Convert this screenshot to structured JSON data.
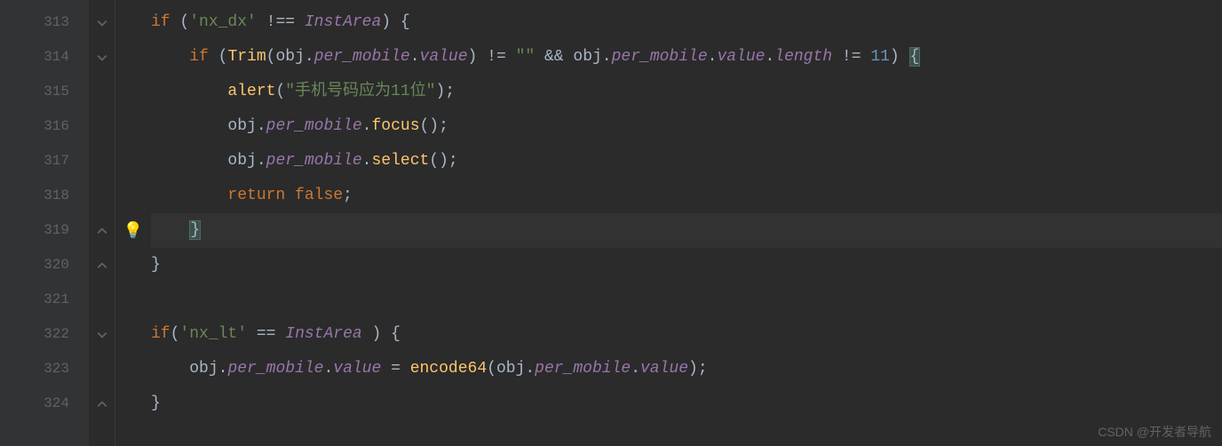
{
  "gutter": {
    "line_numbers": [
      "313",
      "314",
      "315",
      "316",
      "317",
      "318",
      "319",
      "320",
      "321",
      "322",
      "323",
      "324"
    ]
  },
  "fold_markers": {
    "0": "open-start",
    "1": "open-start",
    "6": "close",
    "7": "close",
    "9": "open-start",
    "11": "close"
  },
  "bulb_row_index": 6,
  "highlighted_row_index": 6,
  "code": {
    "lines": [
      [
        {
          "t": "if",
          "c": "k"
        },
        {
          "t": " (",
          "c": "punc"
        },
        {
          "t": "'nx_dx'",
          "c": "s"
        },
        {
          "t": " !== ",
          "c": "punc"
        },
        {
          "t": "InstArea",
          "c": "var-i"
        },
        {
          "t": ") {",
          "c": "punc"
        }
      ],
      [
        {
          "t": "    ",
          "c": "punc"
        },
        {
          "t": "if",
          "c": "k"
        },
        {
          "t": " (",
          "c": "punc"
        },
        {
          "t": "Trim",
          "c": "fn"
        },
        {
          "t": "(",
          "c": "punc"
        },
        {
          "t": "obj",
          "c": "id"
        },
        {
          "t": ".",
          "c": "punc"
        },
        {
          "t": "per_mobile",
          "c": "prop"
        },
        {
          "t": ".",
          "c": "punc"
        },
        {
          "t": "value",
          "c": "prop"
        },
        {
          "t": ") != ",
          "c": "punc"
        },
        {
          "t": "\"\"",
          "c": "s"
        },
        {
          "t": " && ",
          "c": "punc"
        },
        {
          "t": "obj",
          "c": "id"
        },
        {
          "t": ".",
          "c": "punc"
        },
        {
          "t": "per_mobile",
          "c": "prop"
        },
        {
          "t": ".",
          "c": "punc"
        },
        {
          "t": "value",
          "c": "prop"
        },
        {
          "t": ".",
          "c": "punc"
        },
        {
          "t": "length",
          "c": "prop"
        },
        {
          "t": " != ",
          "c": "punc"
        },
        {
          "t": "11",
          "c": "num"
        },
        {
          "t": ") ",
          "c": "punc"
        },
        {
          "t": "{",
          "c": "punc brace-match"
        }
      ],
      [
        {
          "t": "        ",
          "c": "punc"
        },
        {
          "t": "alert",
          "c": "fn"
        },
        {
          "t": "(",
          "c": "punc"
        },
        {
          "t": "\"手机号码应为11位\"",
          "c": "s-cn"
        },
        {
          "t": ");",
          "c": "punc"
        }
      ],
      [
        {
          "t": "        ",
          "c": "punc"
        },
        {
          "t": "obj",
          "c": "id"
        },
        {
          "t": ".",
          "c": "punc"
        },
        {
          "t": "per_mobile",
          "c": "prop"
        },
        {
          "t": ".",
          "c": "punc"
        },
        {
          "t": "focus",
          "c": "propfn"
        },
        {
          "t": "();",
          "c": "punc"
        }
      ],
      [
        {
          "t": "        ",
          "c": "punc"
        },
        {
          "t": "obj",
          "c": "id"
        },
        {
          "t": ".",
          "c": "punc"
        },
        {
          "t": "per_mobile",
          "c": "prop"
        },
        {
          "t": ".",
          "c": "punc"
        },
        {
          "t": "select",
          "c": "propfn"
        },
        {
          "t": "();",
          "c": "punc"
        }
      ],
      [
        {
          "t": "        ",
          "c": "punc"
        },
        {
          "t": "return false",
          "c": "k"
        },
        {
          "t": ";",
          "c": "punc"
        }
      ],
      [
        {
          "t": "    ",
          "c": "punc"
        },
        {
          "t": "}",
          "c": "punc brace-match"
        }
      ],
      [
        {
          "t": "}",
          "c": "punc"
        }
      ],
      [
        {
          "t": "",
          "c": "punc"
        }
      ],
      [
        {
          "t": "if",
          "c": "k"
        },
        {
          "t": "(",
          "c": "punc"
        },
        {
          "t": "'nx_lt'",
          "c": "s"
        },
        {
          "t": " == ",
          "c": "punc"
        },
        {
          "t": "InstArea",
          "c": "var-i"
        },
        {
          "t": " ) {",
          "c": "punc"
        }
      ],
      [
        {
          "t": "    ",
          "c": "punc"
        },
        {
          "t": "obj",
          "c": "id"
        },
        {
          "t": ".",
          "c": "punc"
        },
        {
          "t": "per_mobile",
          "c": "prop"
        },
        {
          "t": ".",
          "c": "punc"
        },
        {
          "t": "value",
          "c": "prop"
        },
        {
          "t": " = ",
          "c": "punc"
        },
        {
          "t": "encode64",
          "c": "fn"
        },
        {
          "t": "(",
          "c": "punc"
        },
        {
          "t": "obj",
          "c": "id"
        },
        {
          "t": ".",
          "c": "punc"
        },
        {
          "t": "per_mobile",
          "c": "prop"
        },
        {
          "t": ".",
          "c": "punc"
        },
        {
          "t": "value",
          "c": "prop"
        },
        {
          "t": ");",
          "c": "punc"
        }
      ],
      [
        {
          "t": "}",
          "c": "punc"
        }
      ]
    ]
  },
  "watermark": "CSDN @开发者导航"
}
